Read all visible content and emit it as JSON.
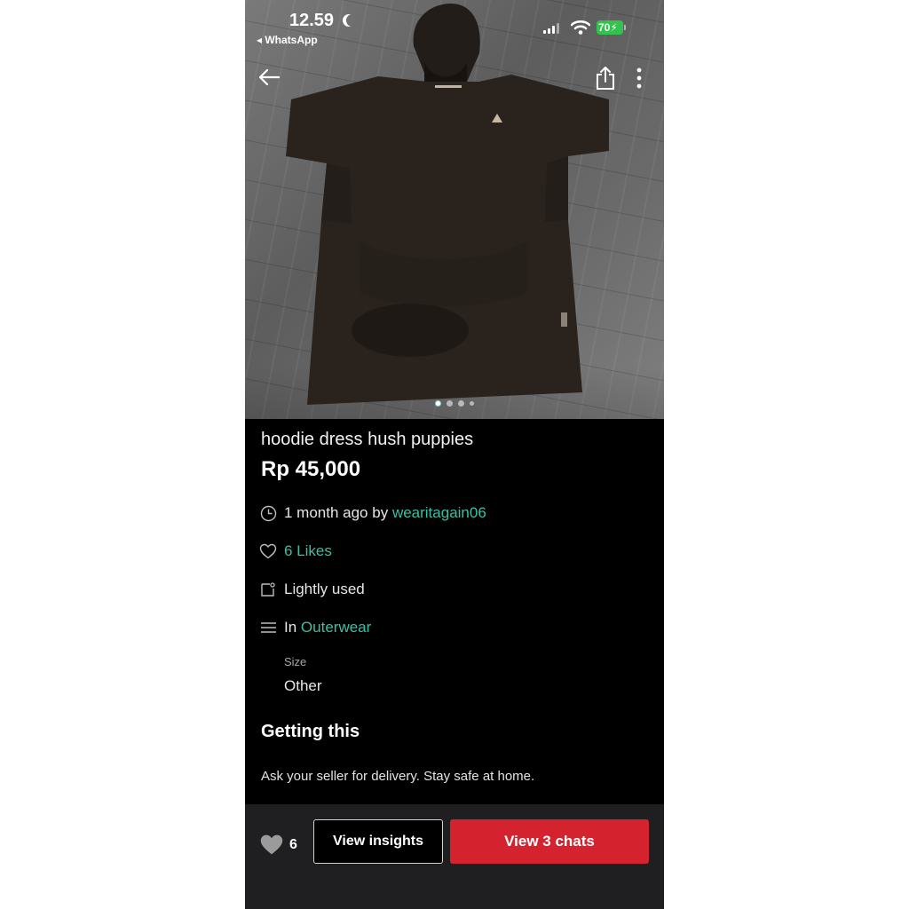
{
  "status_bar": {
    "time": "12.59",
    "back_app": "◂ WhatsApp",
    "battery": "70"
  },
  "nav": {
    "back_icon": "arrow-left-icon",
    "share_icon": "share-icon",
    "more_icon": "more-vertical-icon"
  },
  "gallery": {
    "photo_count": 4,
    "active_index": 0
  },
  "listing": {
    "title": "hoodie dress hush puppies",
    "price": "Rp 45,000",
    "posted": "1 month ago by",
    "seller": "wearitagain06",
    "likes": "6 Likes",
    "condition": "Lightly used",
    "category_prefix": "In",
    "category": "Outerwear",
    "size_label": "Size",
    "size_value": "Other"
  },
  "getting": {
    "title": "Getting this",
    "text": "Ask your seller for delivery. Stay safe at home."
  },
  "bottom": {
    "like_count": "6",
    "insights_label": "View insights",
    "chats_label": "View 3 chats"
  },
  "colors": {
    "accent": "#3cbfa4",
    "primary_button": "#d4232e",
    "background": "#000000"
  }
}
